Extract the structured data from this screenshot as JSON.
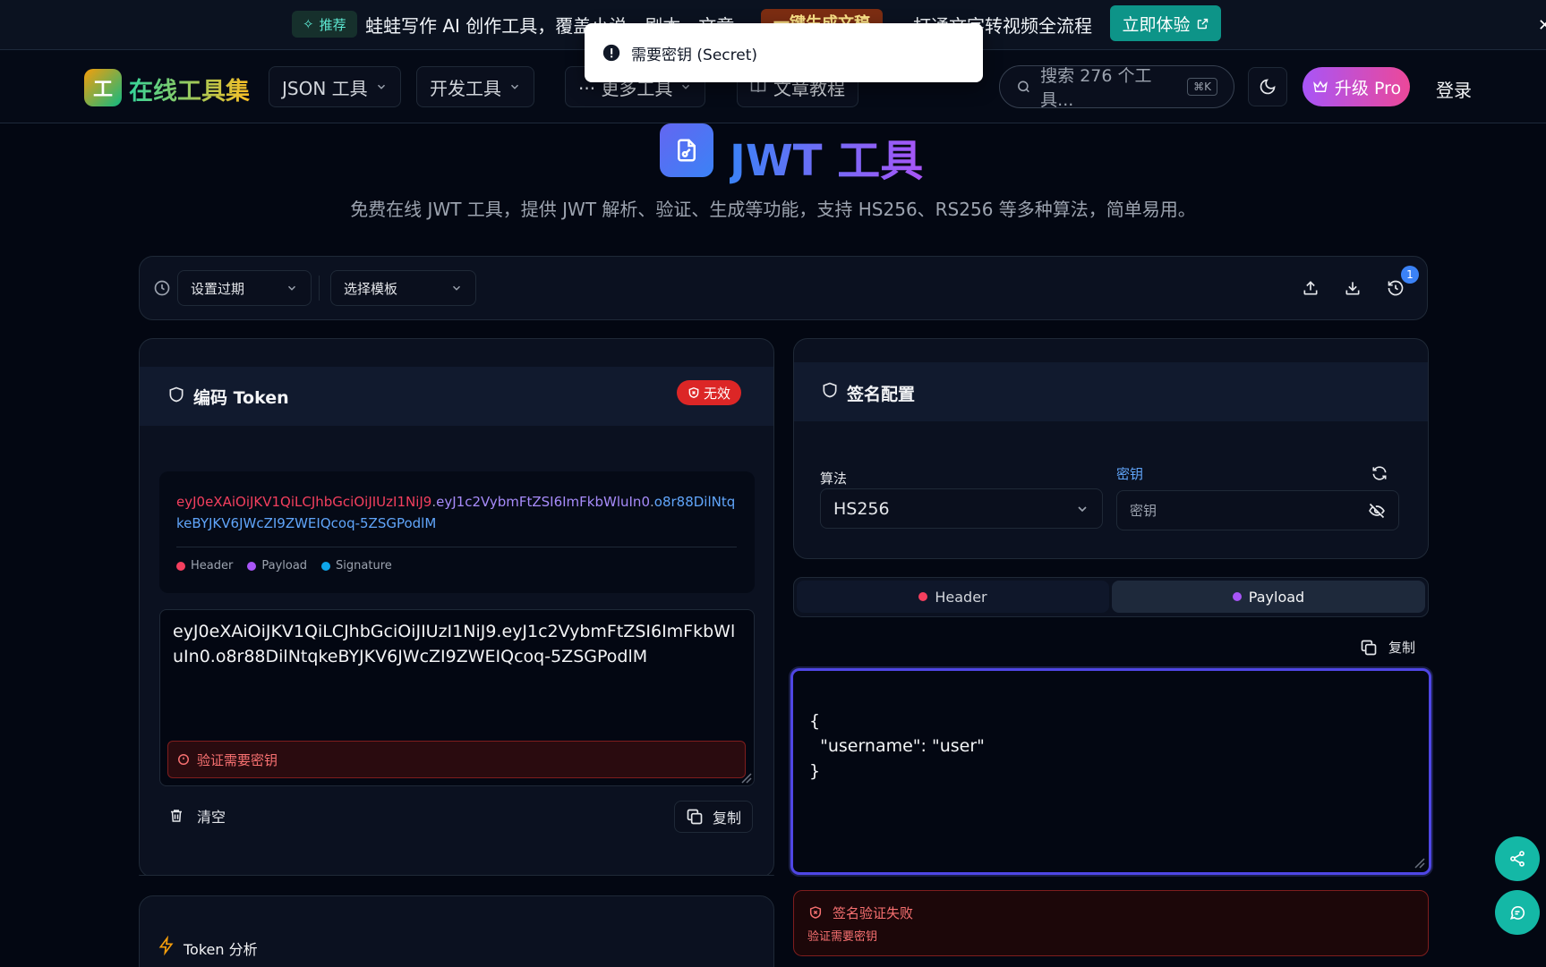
{
  "promo": {
    "badge": "推荐",
    "text_left": "蛙蛙写作 AI 创作工具，覆盖小说、剧本、文章",
    "chip": "一键生成文稿",
    "text_right": "打通文字转视频全流程",
    "cta": "立即体验"
  },
  "toast": {
    "text": "需要密钥 (Secret)"
  },
  "nav": {
    "logo_letter": "工",
    "logo_text": "在线工具集",
    "items": [
      "JSON 工具",
      "开发工具",
      "··· 更多工具",
      "文章教程"
    ],
    "search_placeholder": "搜索 276 个工具...",
    "search_kbd": "⌘K",
    "pro": "升级 Pro",
    "login": "登录"
  },
  "page": {
    "title": "JWT 工具",
    "subtitle": "免费在线 JWT 工具，提供 JWT 解析、验证、生成等功能，支持 HS256、RS256 等多种算法，简单易用。"
  },
  "toolbar": {
    "expiry": "设置过期",
    "template": "选择模板",
    "history_count": "1"
  },
  "encoded": {
    "title": "编码 Token",
    "status": "无效",
    "token_header": "eyJ0eXAiOiJKV1QiLCJhbGciOiJIUzI1NiJ9",
    "token_payload": "eyJ1c2VybmFtZSI6ImFkbWluIn0",
    "token_signature": "o8r88DilNtqkeBYJKV6JWcZI9ZWEIQcoq-5ZSGPodlM",
    "legend": {
      "header": "Header",
      "payload": "Payload",
      "signature": "Signature"
    },
    "textarea_value": "eyJ0eXAiOiJKV1QiLCJhbGciOiJIUzI1NiJ9.eyJ1c2VybmFtZSI6ImFkbWluIn0.o8r88DilNtqkeBYJKV6JWcZI9ZWEIQcoq-5ZSGPodlM",
    "error": "验证需要密钥",
    "clear": "清空",
    "copy": "复制"
  },
  "analysis": {
    "title": "Token 分析"
  },
  "signature": {
    "title": "签名配置",
    "algo_label": "算法",
    "algo_value": "HS256",
    "secret_label": "密钥",
    "secret_placeholder": "密钥"
  },
  "decoded": {
    "tabs": [
      "Header",
      "Payload"
    ],
    "copy": "复制",
    "lines": [
      "{",
      "  \"username\": \"user\"",
      "}"
    ]
  },
  "verify": {
    "title": "签名验证失败",
    "detail": "验证需要密钥"
  },
  "colors": {
    "header": "#f43f5e",
    "payload": "#a855f7",
    "signature": "#38bdf8",
    "accent": "#6366f1"
  }
}
